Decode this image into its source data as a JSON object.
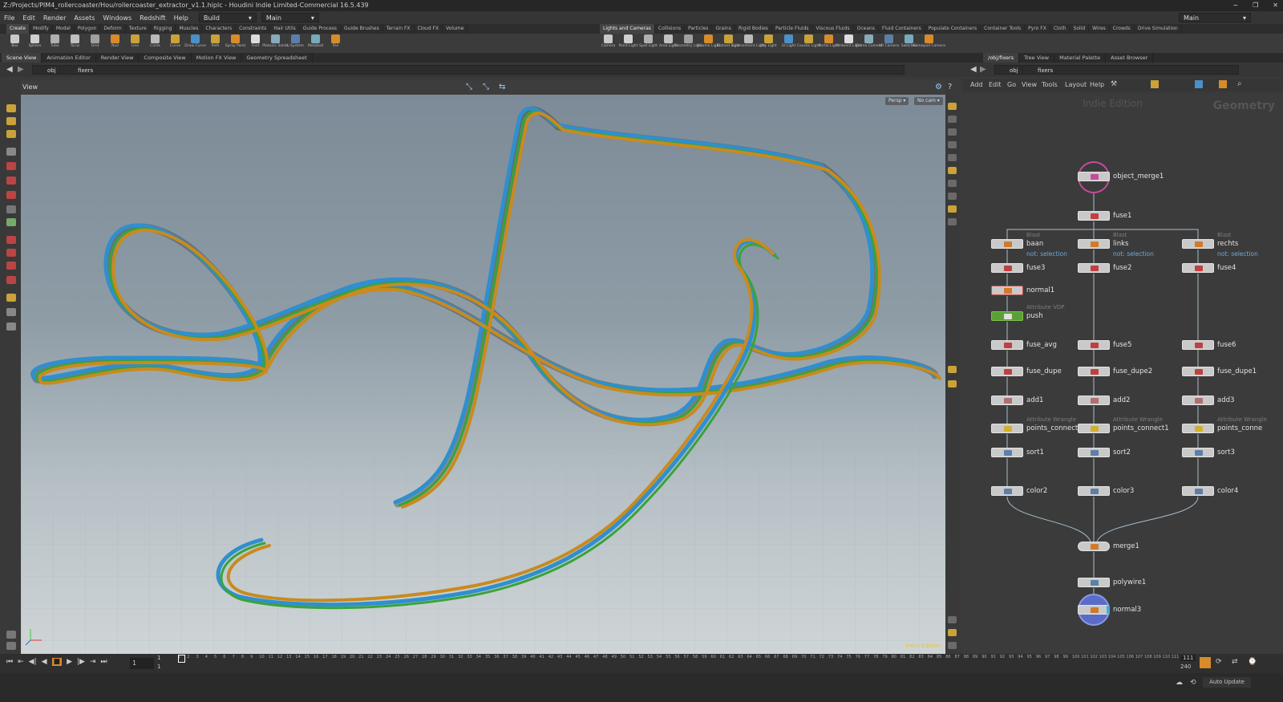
{
  "window": {
    "title": "Z:/Projects/PIM4_rollercoaster/Hou/rollercoaster_extractor_v1.1.hiplc - Houdini Indie Limited-Commercial 16.5.439",
    "controls": [
      "−",
      "❐",
      "✕"
    ]
  },
  "menubar": {
    "items": [
      "File",
      "Edit",
      "Render",
      "Assets",
      "Windows",
      "Redshift",
      "Help"
    ],
    "desktop": "Build",
    "context": "Main",
    "right_desktop": "Main"
  },
  "shelf": {
    "left_tabs": [
      "Create",
      "Modify",
      "Model",
      "Polygon",
      "Deform",
      "Texture",
      "Rigging",
      "Muscles",
      "Characters",
      "Constraints",
      "Hair Utils",
      "Guide Process",
      "Guide Brushes",
      "Terrain FX",
      "Cloud FX",
      "Volume"
    ],
    "right_tabs": [
      "Lights and Cameras",
      "Collisions",
      "Particles",
      "Grains",
      "Rigid Bodies",
      "Particle Fluids",
      "Viscous Fluids",
      "Oceans",
      "Fluid Containers",
      "Populate Containers",
      "Container Tools",
      "Pyro FX",
      "Cloth",
      "Solid",
      "Wires",
      "Crowds",
      "Drive Simulation"
    ],
    "left_tools": [
      "Box",
      "Sphere",
      "Tube",
      "Torus",
      "Grid",
      "Null",
      "Line",
      "Circle",
      "Curve",
      "Draw Curve",
      "Path",
      "Spray Paint",
      "Font",
      "Platonic Solids",
      "L-System",
      "Metaball",
      "File"
    ],
    "right_tools": [
      "Camera",
      "Point Light",
      "Spot Light",
      "Area Light",
      "Geometry Light",
      "Volume Light",
      "Distant Light",
      "Environment Light",
      "Sky Light",
      "GI Light",
      "Caustic Light",
      "Portal Light",
      "Ambient Light",
      "Stereo Camera",
      "VR Camera",
      "Switcher",
      "Gamepad Camera"
    ]
  },
  "left_pane": {
    "tabs": [
      "Scene View",
      "Animation Editor",
      "Render View",
      "Composite View",
      "Motion FX View",
      "Geometry Spreadsheet"
    ],
    "path": [
      "obj",
      "fixers"
    ],
    "view_label": "View",
    "cam_persp": "Persp ▾",
    "cam_nocam": "No cam ▾",
    "edition": "Indie Edition"
  },
  "right_pane": {
    "tabs": [
      "/obj/fixers",
      "Tree View",
      "Material Palette",
      "Asset Browser"
    ],
    "path": [
      "obj",
      "fixers"
    ],
    "menu": [
      "Add",
      "Edit",
      "Go",
      "View",
      "Tools",
      "Layout",
      "Help"
    ],
    "watermark_edition": "Indie Edition",
    "watermark_context": "Geometry"
  },
  "nodes": {
    "object_merge1": "object_merge1",
    "fuse1": "fuse1",
    "baan": {
      "type": "Blast",
      "name": "baan",
      "comment": "not: selection"
    },
    "links": {
      "type": "Blast",
      "name": "links",
      "comment": "not: selection"
    },
    "rechts": {
      "type": "Blast",
      "name": "rechts",
      "comment": "not: selection"
    },
    "fuse3": "fuse3",
    "fuse2": "fuse2",
    "fuse4": "fuse4",
    "normal1": "normal1",
    "push": {
      "type": "Attribute VOP",
      "name": "push"
    },
    "fuse_avg": "fuse_avg",
    "fuse5": "fuse5",
    "fuse6": "fuse6",
    "fuse_dupe": "fuse_dupe",
    "fuse_dupe2": "fuse_dupe2",
    "fuse_dupe1": "fuse_dupe1",
    "add1": "add1",
    "add2": "add2",
    "add3": "add3",
    "pc1": {
      "type": "Attribute Wrangle",
      "name": "points_connect"
    },
    "pc2": {
      "type": "Attribute Wrangle",
      "name": "points_connect1"
    },
    "pc3": {
      "type": "Attribute Wrangle",
      "name": "points_conne"
    },
    "sort1": "sort1",
    "sort2": "sort2",
    "sort3": "sort3",
    "color2": "color2",
    "color3": "color3",
    "color4": "color4",
    "merge1": "merge1",
    "polywire1": "polywire1",
    "normal3": "normal3"
  },
  "timeline": {
    "frame": "1",
    "start": "1",
    "start2": "1",
    "end": "111",
    "end2": "240",
    "ticks": [
      "1",
      "2",
      "3",
      "4",
      "5",
      "6",
      "7",
      "8",
      "9",
      "10",
      "11",
      "12",
      "13",
      "14",
      "15",
      "16",
      "17",
      "18",
      "19",
      "20",
      "21",
      "22",
      "23",
      "24",
      "25",
      "26",
      "27",
      "28",
      "29",
      "30",
      "31",
      "32",
      "33",
      "34",
      "35",
      "36",
      "37",
      "38",
      "39",
      "40",
      "41",
      "42",
      "43",
      "44",
      "45",
      "46",
      "47",
      "48",
      "49",
      "50",
      "51",
      "52",
      "53",
      "54",
      "55",
      "56",
      "57",
      "58",
      "59",
      "60",
      "61",
      "62",
      "63",
      "64",
      "65",
      "66",
      "67",
      "68",
      "69",
      "70",
      "71",
      "72",
      "73",
      "74",
      "75",
      "76",
      "77",
      "78",
      "79",
      "80",
      "81",
      "82",
      "83",
      "84",
      "85",
      "86",
      "87",
      "88",
      "89",
      "90",
      "91",
      "92",
      "93",
      "94",
      "95",
      "96",
      "97",
      "98",
      "99",
      "100",
      "101",
      "102",
      "103",
      "104",
      "105",
      "106",
      "107",
      "108",
      "109",
      "110",
      "111"
    ]
  },
  "status": {
    "auto_update": "Auto Update"
  },
  "colors": {
    "rail_orange": "#c98a1e",
    "rail_blue": "#2f8fcf",
    "rail_green": "#3aa33a",
    "node_push": "#5aa035",
    "comment_blue": "#6fa8dc"
  }
}
